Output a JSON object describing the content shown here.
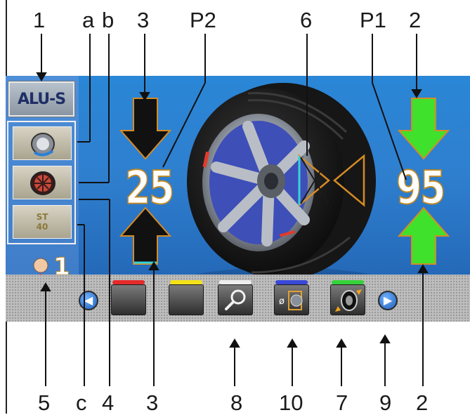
{
  "mode": {
    "label": "ALU-S"
  },
  "readings": {
    "inner_value": "25",
    "outer_value": "95"
  },
  "operator": {
    "number": "1"
  },
  "side_buttons": {
    "st_line1": "ST",
    "st_line2": "40"
  },
  "colors": {
    "arrow_green": "#3fe12c",
    "arrow_black": "#111111",
    "led_red": "#e52a2a",
    "led_yellow": "#f2e21a",
    "led_white": "#eeeeee",
    "led_blue": "#3a48d8",
    "led_green": "#35d23a"
  },
  "icons": {
    "mode": "alu-s-mode-icon",
    "wheel_weight_clip": "clip-on-weight-icon",
    "wheel_weight_adhesive": "adhesive-weight-icon",
    "operator": "operator-icon",
    "search": "magnifier-icon",
    "rim_dimension": "rim-diameter-icon",
    "wheel_rotate": "wheel-rotate-icon",
    "prev": "arrow-left-icon",
    "next": "arrow-right-icon"
  },
  "callouts": {
    "top": [
      "1",
      "a",
      "b",
      "3",
      "P2",
      "6",
      "P1",
      "2"
    ],
    "bottom": [
      "5",
      "c",
      "4",
      "3",
      "8",
      "10",
      "7",
      "9",
      "2"
    ]
  }
}
